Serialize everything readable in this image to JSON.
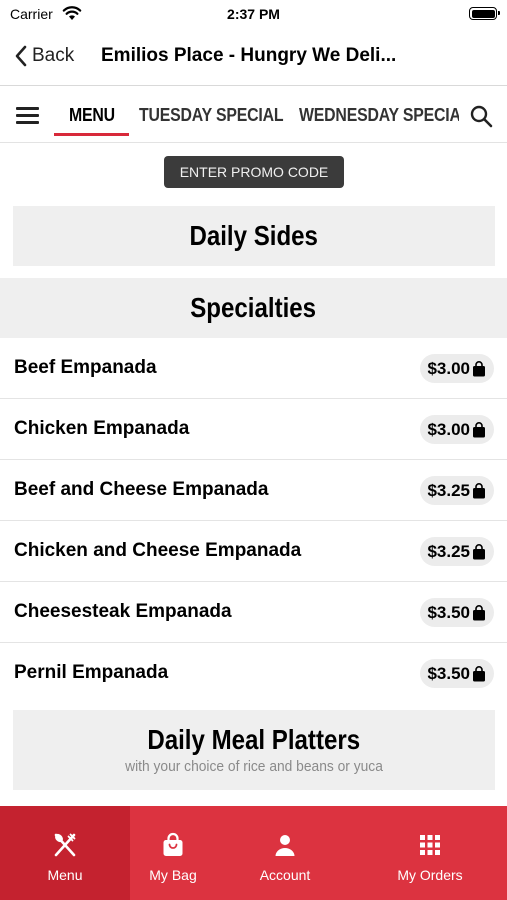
{
  "status_bar": {
    "carrier": "Carrier",
    "time": "2:37 PM"
  },
  "nav": {
    "back_label": "Back",
    "title": "Emilios Place - Hungry We Deli..."
  },
  "tabs": [
    {
      "label": "MENU"
    },
    {
      "label": "TUESDAY SPECIAL"
    },
    {
      "label": "WEDNESDAY SPECIAL"
    }
  ],
  "promo": {
    "label": "ENTER PROMO CODE"
  },
  "sections": {
    "daily_sides": {
      "title": "Daily Sides"
    },
    "specialties": {
      "title": "Specialties"
    },
    "daily_meal_platters": {
      "title": "Daily Meal Platters",
      "subtitle": "with your choice of rice and beans or yuca"
    }
  },
  "items": [
    {
      "name": "Beef Empanada",
      "price": "$3.00"
    },
    {
      "name": "Chicken Empanada",
      "price": "$3.00"
    },
    {
      "name": "Beef and Cheese Empanada",
      "price": "$3.25"
    },
    {
      "name": "Chicken and Cheese Empanada",
      "price": "$3.25"
    },
    {
      "name": "Cheesesteak Empanada",
      "price": "$3.50"
    },
    {
      "name": "Pernil Empanada",
      "price": "$3.50"
    }
  ],
  "bottom_nav": [
    {
      "label": "Menu",
      "icon": "fork-knife-icon"
    },
    {
      "label": "My Bag",
      "icon": "bag-icon"
    },
    {
      "label": "Account",
      "icon": "person-icon"
    },
    {
      "label": "My Orders",
      "icon": "grid-icon"
    }
  ],
  "colors": {
    "accent": "#dc3340",
    "accent_active": "#c4222f",
    "promo_bg": "#3b3b3b"
  }
}
